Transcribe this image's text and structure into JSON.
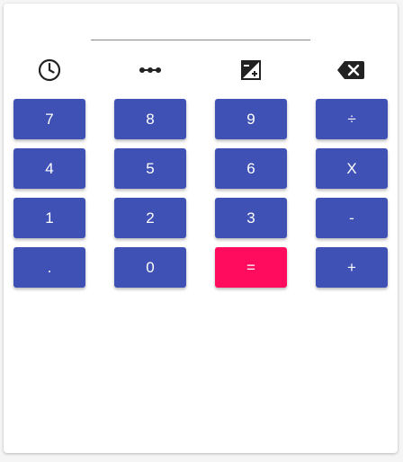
{
  "display": {
    "value": ""
  },
  "toolbar": {
    "icons": [
      "history-icon",
      "line-options-icon",
      "plus-minus-icon",
      "backspace-icon"
    ]
  },
  "keypad": {
    "row1": [
      "7",
      "8",
      "9",
      "÷"
    ],
    "row2": [
      "4",
      "5",
      "6",
      "X"
    ],
    "row3": [
      "1",
      "2",
      "3",
      "-"
    ],
    "row4": [
      ".",
      "0",
      "=",
      "+"
    ]
  },
  "colors": {
    "key": "#3f51b5",
    "equals": "#ff0c5f",
    "key_text": "#ffffff",
    "icon": "#222222"
  }
}
